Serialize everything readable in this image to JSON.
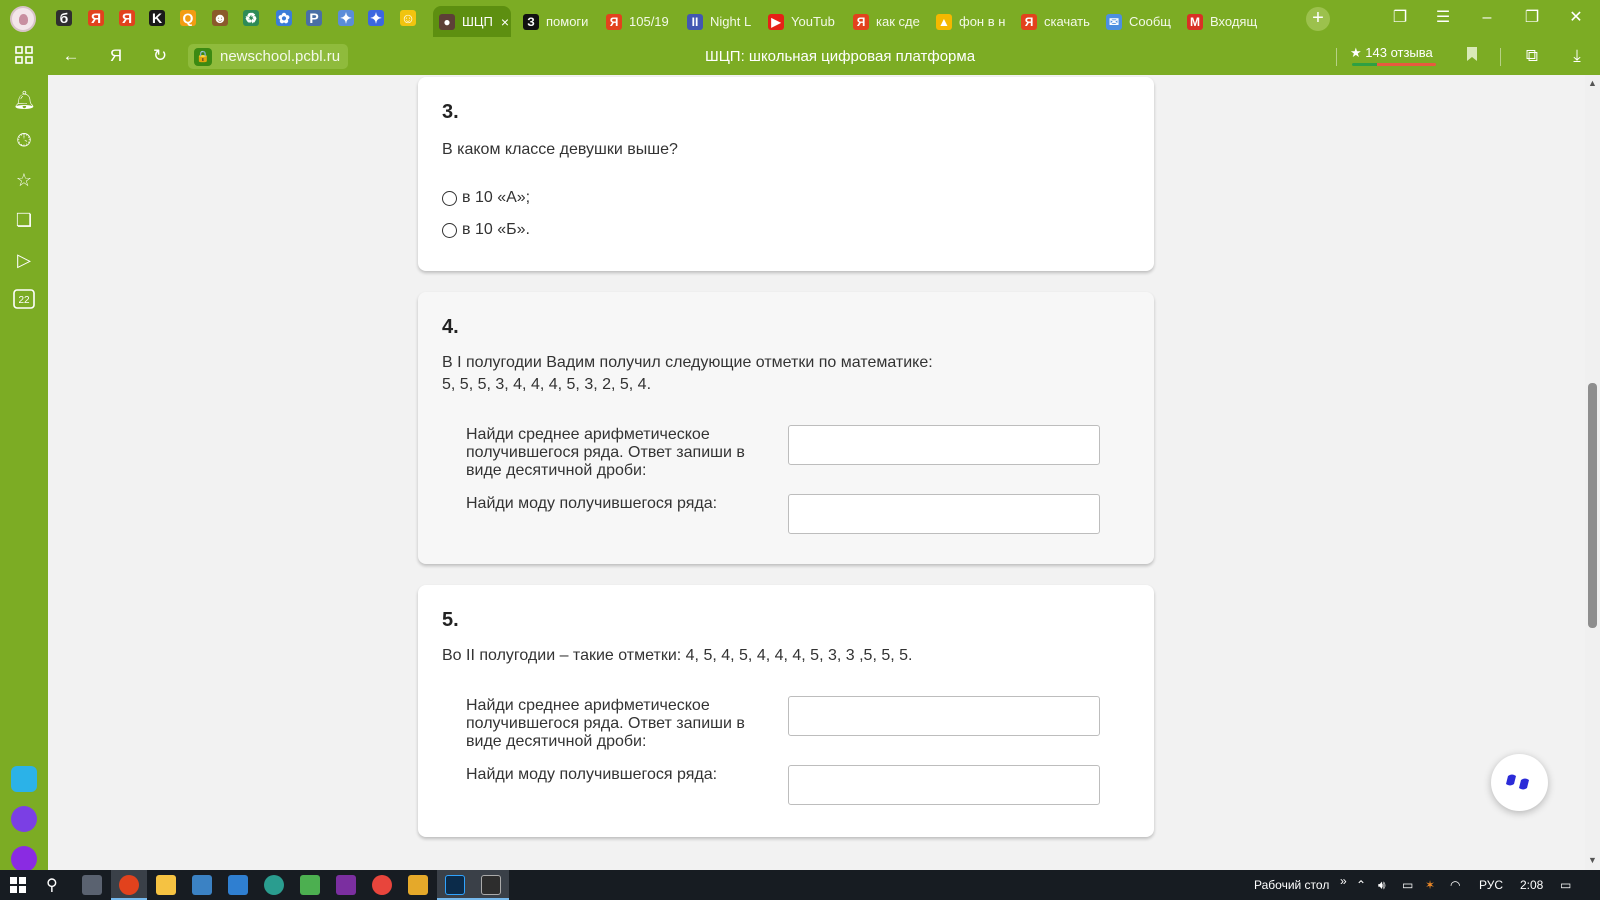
{
  "browser": {
    "tabs": [
      {
        "label": "",
        "color": "#2f2f2f",
        "glyph": "б"
      },
      {
        "label": "",
        "color": "#e2421d",
        "glyph": "Я"
      },
      {
        "label": "",
        "color": "#e2421d",
        "glyph": "Я"
      },
      {
        "label": "",
        "color": "#1a1a1a",
        "glyph": "K"
      },
      {
        "label": "",
        "color": "#f39c12",
        "glyph": "Q"
      },
      {
        "label": "",
        "color": "#8b5a2b",
        "glyph": "☻"
      },
      {
        "label": "",
        "color": "#2e8b57",
        "glyph": "♻"
      },
      {
        "label": "",
        "color": "#3b7dd8",
        "glyph": "✿"
      },
      {
        "label": "",
        "color": "#4a6fa5",
        "glyph": "P"
      },
      {
        "label": "",
        "color": "#5b8dd9",
        "glyph": "✦"
      },
      {
        "label": "",
        "color": "#3c67e0",
        "glyph": "✦"
      },
      {
        "label": "",
        "color": "#f1c40f",
        "glyph": "☺"
      },
      {
        "label": "ШЦП",
        "color": "#5d4037",
        "glyph": "●"
      },
      {
        "label": "помоги",
        "color": "#111111",
        "glyph": "З"
      },
      {
        "label": "105/19",
        "color": "#e2421d",
        "glyph": "Я"
      },
      {
        "label": "Night L",
        "color": "#4257b2",
        "glyph": "II"
      },
      {
        "label": "YouTub",
        "color": "#e62117",
        "glyph": "▶"
      },
      {
        "label": "как сде",
        "color": "#e2421d",
        "glyph": "Я"
      },
      {
        "label": "фон в н",
        "color": "#f5b800",
        "glyph": "▲"
      },
      {
        "label": "скачать",
        "color": "#e2421d",
        "glyph": "Я"
      },
      {
        "label": "Сообщ",
        "color": "#4c8fe0",
        "glyph": "✉"
      },
      {
        "label": "Входящ",
        "color": "#d93025",
        "glyph": "M"
      }
    ],
    "active_tab_close": "×",
    "new_tab": "+",
    "url": "newschool.pcbl.ru",
    "title": "ШЦП: школьная цифровая платформа",
    "reviews": "★ 143 отзыва"
  },
  "questions": [
    {
      "number": "3.",
      "text": "В каком классе девушки выше?",
      "options": [
        "в 10 «А»;",
        "в 10 «Б»."
      ]
    },
    {
      "number": "4.",
      "text_lines": [
        "В I полугодии Вадим получил следующие отметки по математике:",
        "5, 5, 5, 3, 4, 4, 4, 5, 3, 2, 5, 4."
      ],
      "fields": [
        {
          "label": "Найди среднее арифметическое получившегося ряда. Ответ запиши в виде десятичной дроби:",
          "value": ""
        },
        {
          "label": "Найди моду получившегося ряда:",
          "value": ""
        }
      ]
    },
    {
      "number": "5.",
      "text": "Во II полугодии – такие отметки: 4, 5, 4, 5, 4, 4, 4, 5, 3, 3 ,5, 5, 5.",
      "fields": [
        {
          "label": "Найди среднее арифметическое получившегося ряда. Ответ запиши в виде десятичной дроби:",
          "value": ""
        },
        {
          "label": "Найди моду получившегося ряда:",
          "value": ""
        }
      ]
    }
  ],
  "taskbar": {
    "desktop_label": "Рабочий стол",
    "chevron": "»",
    "language": "РУС",
    "time": "2:08"
  }
}
